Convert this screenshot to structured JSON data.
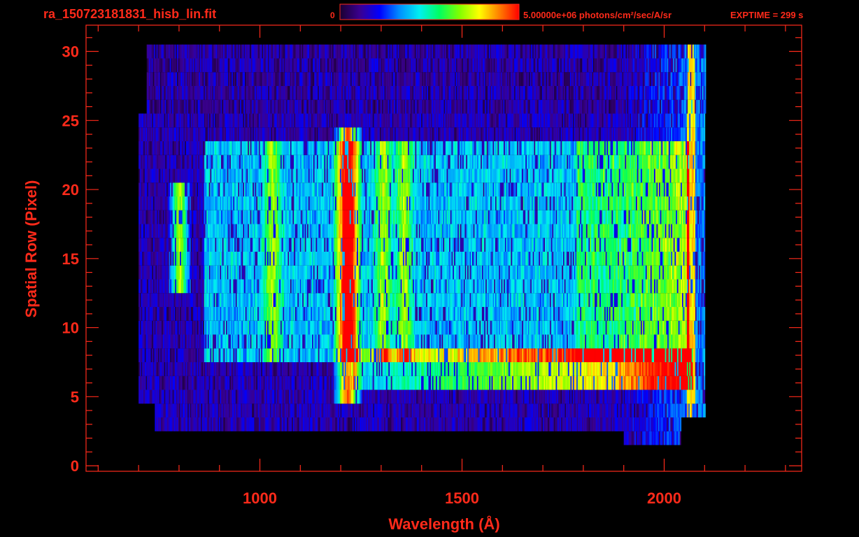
{
  "chart_data": {
    "type": "heatmap",
    "title": "ra_150723181831_hisb_lin.fit",
    "xlabel": "Wavelength (Å)",
    "ylabel": "Spatial Row (Pixel)",
    "xlim": [
      570,
      2340
    ],
    "ylim": [
      -0.4,
      31.9
    ],
    "x_ticks": [
      1000,
      1500,
      2000
    ],
    "y_ticks": [
      0,
      5,
      10,
      15,
      20,
      25,
      30
    ],
    "colorbar": {
      "min_label": "0",
      "max_label": "5.00000e+06 photons/cm²/sec/A/sr",
      "min": 0,
      "max": 5000000
    },
    "annotation": "EXPTIME = 299 s",
    "colors": {
      "axis": "#ff2a1a",
      "background": "#000000",
      "colormap": [
        "#1a0030",
        "#3a0090",
        "#0000ff",
        "#0090ff",
        "#00f0f0",
        "#00ff60",
        "#80ff00",
        "#ffff00",
        "#ff8000",
        "#ff0000"
      ]
    },
    "emission_features": [
      {
        "wavelength": 800,
        "rows": [
          13,
          20
        ]
      },
      {
        "wavelength": 1030,
        "rows": [
          8,
          23
        ]
      },
      {
        "wavelength": 1216,
        "rows": [
          5,
          24
        ]
      },
      {
        "wavelength": 1304,
        "rows": [
          8,
          23
        ]
      },
      {
        "wavelength": 1356,
        "rows": [
          8,
          23
        ]
      }
    ],
    "continuum_rows": [
      6,
      8
    ],
    "continuum_range": [
      1230,
      2070
    ],
    "data_extent": {
      "wavelength": [
        700,
        2100
      ],
      "rows": [
        2,
        30
      ]
    }
  }
}
